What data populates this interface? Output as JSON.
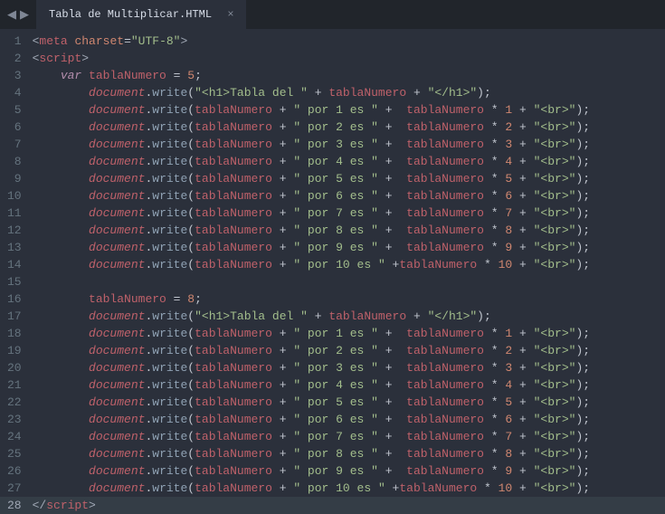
{
  "tab": {
    "title": "Tabla de Multiplicar.HTML",
    "close_glyph": "×"
  },
  "nav": {
    "left": "◀",
    "right": "▶"
  },
  "gutter": {
    "lines": [
      "1",
      "2",
      "3",
      "4",
      "5",
      "6",
      "7",
      "8",
      "9",
      "10",
      "11",
      "12",
      "13",
      "14",
      "15",
      "16",
      "17",
      "18",
      "19",
      "20",
      "21",
      "22",
      "23",
      "24",
      "25",
      "26",
      "27",
      "28"
    ],
    "highlighted": 28
  },
  "code": {
    "meta_open": "<",
    "meta_tag": "meta",
    "meta_attr1": "charset",
    "meta_eq": "=",
    "meta_val": "\"UTF-8\"",
    "meta_close": ">",
    "script_open_lt": "<",
    "script_tag": "script",
    "script_open_gt": ">",
    "var_kw": "var",
    "var_name": "tablaNumero",
    "assign": " = ",
    "five": "5",
    "eight": "8",
    "semi": ";",
    "doc": "document",
    "dot": ".",
    "write": "write",
    "lpar": "(",
    "rpar": ")",
    "h1_open": "\"<h1>Tabla del \"",
    "h1_close": "\"</h1>\"",
    "plus": " + ",
    "plus_tight_l": " +",
    "star": " * ",
    "br": "\"<br>\"",
    "por_pre": "\" por ",
    "por_suf": " es \"",
    "n1": "1",
    "n2": "2",
    "n3": "3",
    "n4": "4",
    "n5": "5",
    "n6": "6",
    "n7": "7",
    "n8": "8",
    "n9": "9",
    "n10": "10",
    "script_close_lt": "</",
    "script_close_gt": ">"
  }
}
